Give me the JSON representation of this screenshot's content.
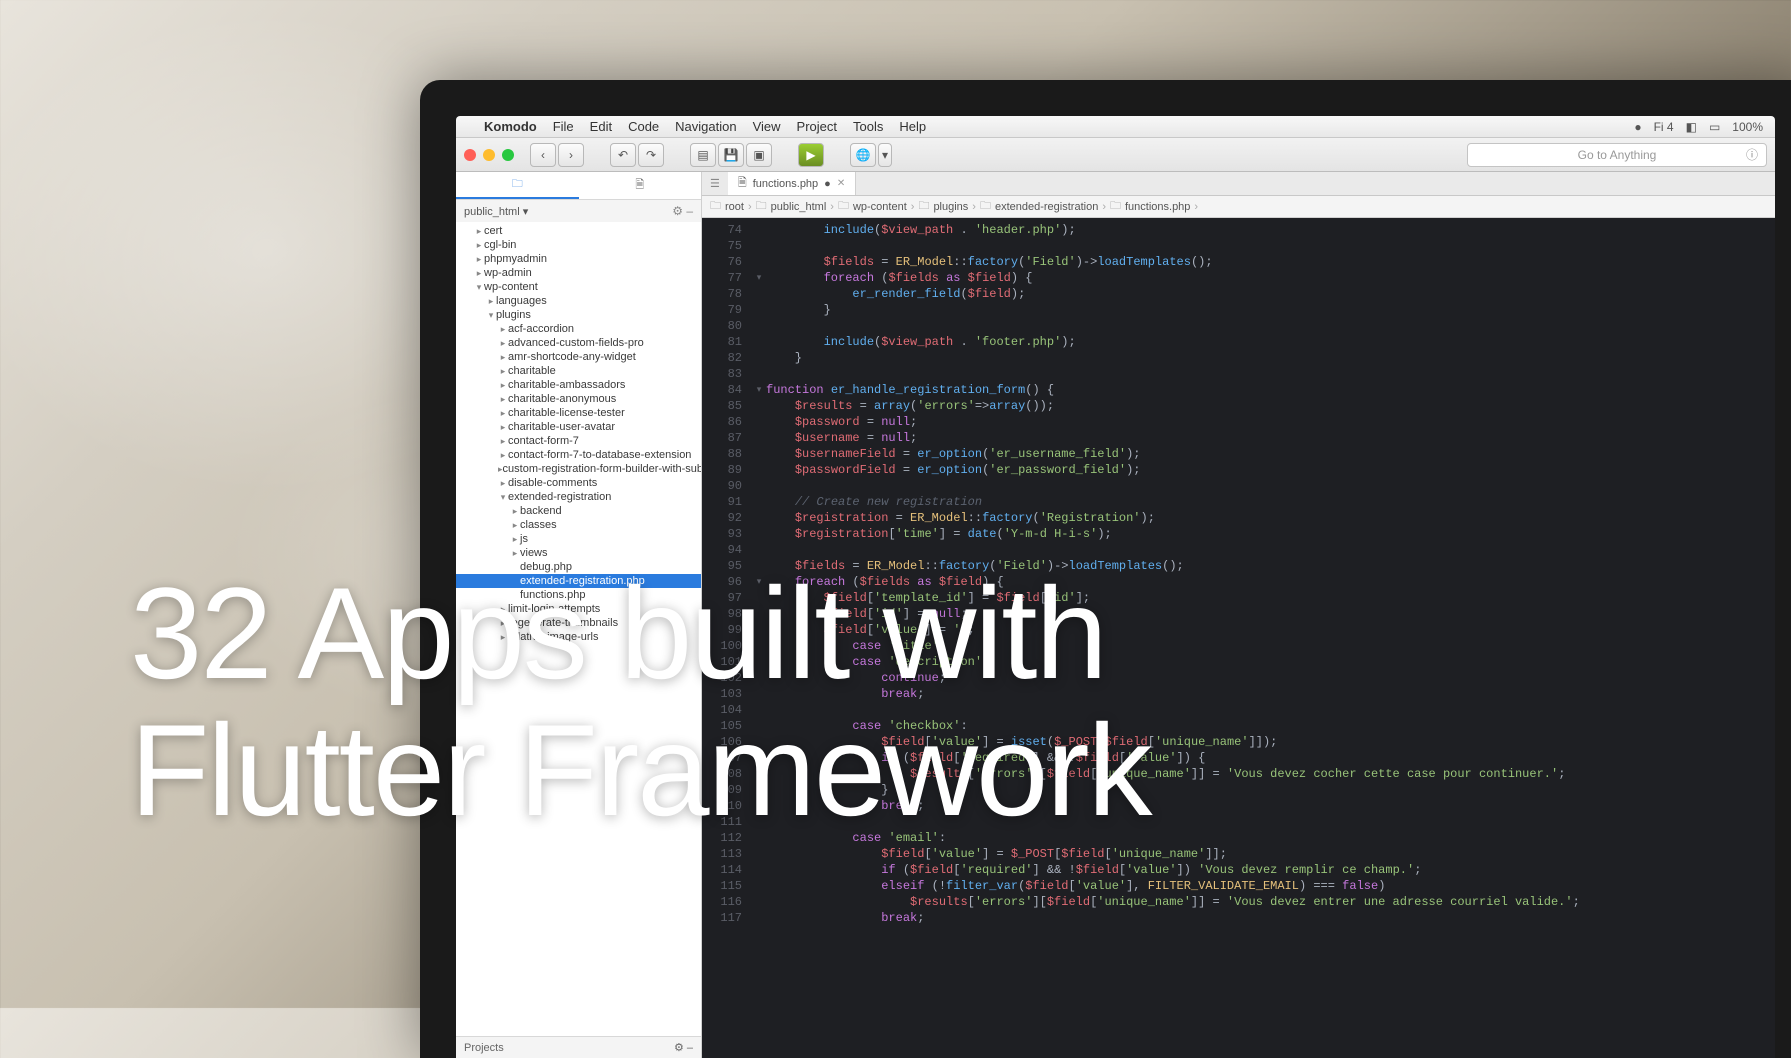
{
  "hero": {
    "line1": "32 Apps built with",
    "line2": "Flutter Framework"
  },
  "menubar": {
    "app": "Komodo",
    "items": [
      "File",
      "Edit",
      "Code",
      "Navigation",
      "View",
      "Project",
      "Tools",
      "Help"
    ],
    "right": [
      "Fi 4",
      "◧",
      "100%"
    ]
  },
  "toolbar": {
    "search_placeholder": "Go to Anything"
  },
  "sidebar": {
    "header": "public_html",
    "footer": "Projects",
    "tree": [
      {
        "d": 1,
        "a": ">",
        "t": "cert"
      },
      {
        "d": 1,
        "a": ">",
        "t": "cgl-bin"
      },
      {
        "d": 1,
        "a": ">",
        "t": "phpmyadmin"
      },
      {
        "d": 1,
        "a": ">",
        "t": "wp-admin"
      },
      {
        "d": 1,
        "a": "v",
        "t": "wp-content"
      },
      {
        "d": 2,
        "a": ">",
        "t": "languages"
      },
      {
        "d": 2,
        "a": "v",
        "t": "plugins"
      },
      {
        "d": 3,
        "a": ">",
        "t": "acf-accordion"
      },
      {
        "d": 3,
        "a": ">",
        "t": "advanced-custom-fields-pro"
      },
      {
        "d": 3,
        "a": ">",
        "t": "amr-shortcode-any-widget"
      },
      {
        "d": 3,
        "a": ">",
        "t": "charitable"
      },
      {
        "d": 3,
        "a": ">",
        "t": "charitable-ambassadors"
      },
      {
        "d": 3,
        "a": ">",
        "t": "charitable-anonymous"
      },
      {
        "d": 3,
        "a": ">",
        "t": "charitable-license-tester"
      },
      {
        "d": 3,
        "a": ">",
        "t": "charitable-user-avatar"
      },
      {
        "d": 3,
        "a": ">",
        "t": "contact-form-7"
      },
      {
        "d": 3,
        "a": ">",
        "t": "contact-form-7-to-database-extension"
      },
      {
        "d": 3,
        "a": ">",
        "t": "custom-registration-form-builder-with-submissi"
      },
      {
        "d": 3,
        "a": ">",
        "t": "disable-comments"
      },
      {
        "d": 3,
        "a": "v",
        "t": "extended-registration"
      },
      {
        "d": 4,
        "a": ">",
        "t": "backend"
      },
      {
        "d": 4,
        "a": ">",
        "t": "classes"
      },
      {
        "d": 4,
        "a": ">",
        "t": "js"
      },
      {
        "d": 4,
        "a": ">",
        "t": "views"
      },
      {
        "d": 4,
        "a": "",
        "t": "debug.php"
      },
      {
        "d": 4,
        "a": "",
        "t": "extended-registration.php",
        "sel": true
      },
      {
        "d": 4,
        "a": "",
        "t": "functions.php"
      },
      {
        "d": 3,
        "a": ">",
        "t": "limit-login-attempts"
      },
      {
        "d": 3,
        "a": ">",
        "t": "regenerate-thumbnails"
      },
      {
        "d": 3,
        "a": ">",
        "t": "relative-image-urls"
      }
    ]
  },
  "editor": {
    "tab": "functions.php",
    "crumbs": [
      "root",
      "public_html",
      "wp-content",
      "plugins",
      "extended-registration",
      "functions.php"
    ],
    "lines": [
      {
        "n": 74,
        "html": "        <span class='fn'>include</span>(<span class='var'>$view_path</span> . <span class='str'>'header.php'</span>);"
      },
      {
        "n": 75,
        "html": ""
      },
      {
        "n": 76,
        "html": "        <span class='var'>$fields</span> = <span class='cls'>ER_Model</span>::<span class='fn'>factory</span>(<span class='str'>'Field'</span>)-><span class='fn'>loadTemplates</span>();"
      },
      {
        "n": 77,
        "fold": "v",
        "html": "        <span class='kw'>foreach</span> (<span class='var'>$fields</span> <span class='kw'>as</span> <span class='var'>$field</span>) {"
      },
      {
        "n": 78,
        "html": "            <span class='fn'>er_render_field</span>(<span class='var'>$field</span>);"
      },
      {
        "n": 79,
        "html": "        }"
      },
      {
        "n": 80,
        "html": ""
      },
      {
        "n": 81,
        "html": "        <span class='fn'>include</span>(<span class='var'>$view_path</span> . <span class='str'>'footer.php'</span>);"
      },
      {
        "n": 82,
        "html": "    }"
      },
      {
        "n": 83,
        "html": ""
      },
      {
        "n": 84,
        "fold": "v",
        "html": "<span class='kw'>function</span> <span class='fn'>er_handle_registration_form</span>() {"
      },
      {
        "n": 85,
        "html": "    <span class='var'>$results</span> = <span class='fn'>array</span>(<span class='str'>'errors'</span>=><span class='fn'>array</span>());"
      },
      {
        "n": 86,
        "html": "    <span class='var'>$password</span> = <span class='kw'>null</span>;"
      },
      {
        "n": 87,
        "html": "    <span class='var'>$username</span> = <span class='kw'>null</span>;"
      },
      {
        "n": 88,
        "html": "    <span class='var'>$usernameField</span> = <span class='fn'>er_option</span>(<span class='str'>'er_username_field'</span>);"
      },
      {
        "n": 89,
        "html": "    <span class='var'>$passwordField</span> = <span class='fn'>er_option</span>(<span class='str'>'er_password_field'</span>);"
      },
      {
        "n": 90,
        "html": ""
      },
      {
        "n": 91,
        "html": "    <span class='cmt'>// Create new registration</span>"
      },
      {
        "n": 92,
        "html": "    <span class='var'>$registration</span> = <span class='cls'>ER_Model</span>::<span class='fn'>factory</span>(<span class='str'>'Registration'</span>);"
      },
      {
        "n": 93,
        "html": "    <span class='var'>$registration</span>[<span class='str'>'time'</span>] = <span class='fn'>date</span>(<span class='str'>'Y-m-d H-i-s'</span>);"
      },
      {
        "n": 94,
        "html": ""
      },
      {
        "n": 95,
        "html": "    <span class='var'>$fields</span> = <span class='cls'>ER_Model</span>::<span class='fn'>factory</span>(<span class='str'>'Field'</span>)-><span class='fn'>loadTemplates</span>();"
      },
      {
        "n": 96,
        "fold": "v",
        "html": "    <span class='kw'>foreach</span> (<span class='var'>$fields</span> <span class='kw'>as</span> <span class='var'>$field</span>) {"
      },
      {
        "n": 97,
        "html": "        <span class='var'>$field</span>[<span class='str'>'template_id'</span>] = <span class='var'>$field</span>[<span class='str'>'id'</span>];"
      },
      {
        "n": 98,
        "html": "        <span class='var'>$field</span>[<span class='str'>'id'</span>] = <span class='kw'>null</span>;"
      },
      {
        "n": 99,
        "html": "        <span class='var'>$field</span>[<span class='str'>'value'</span>] = <span class='str'>''</span>;"
      },
      {
        "n": 100,
        "html": "            <span class='kw'>case</span> <span class='str'>'title'</span>:"
      },
      {
        "n": 101,
        "html": "            <span class='kw'>case</span> <span class='str'>'description'</span>:"
      },
      {
        "n": 102,
        "html": "                <span class='kw'>continue</span>;"
      },
      {
        "n": 103,
        "html": "                <span class='kw'>break</span>;"
      },
      {
        "n": 104,
        "html": ""
      },
      {
        "n": 105,
        "html": "            <span class='kw'>case</span> <span class='str'>'checkbox'</span>:"
      },
      {
        "n": 106,
        "html": "                <span class='var'>$field</span>[<span class='str'>'value'</span>] = <span class='fn'>isset</span>(<span class='var'>$_POST</span>[<span class='var'>$field</span>[<span class='str'>'unique_name'</span>]]);"
      },
      {
        "n": 107,
        "html": "                <span class='kw'>if</span> (<span class='var'>$field</span>[<span class='str'>'required'</span>] && !<span class='var'>$field</span>[<span class='str'>'value'</span>]) {"
      },
      {
        "n": 108,
        "html": "                    <span class='var'>$results</span>[<span class='str'>'errors'</span>][<span class='var'>$field</span>[<span class='str'>'unique_name'</span>]] = <span class='str'>'Vous devez cocher cette case pour continuer.'</span>;"
      },
      {
        "n": 109,
        "html": "                }"
      },
      {
        "n": 110,
        "html": "                <span class='kw'>break</span>;"
      },
      {
        "n": 111,
        "html": ""
      },
      {
        "n": 112,
        "html": "            <span class='kw'>case</span> <span class='str'>'email'</span>:"
      },
      {
        "n": 113,
        "html": "                <span class='var'>$field</span>[<span class='str'>'value'</span>] = <span class='var'>$_POST</span>[<span class='var'>$field</span>[<span class='str'>'unique_name'</span>]];"
      },
      {
        "n": 114,
        "html": "                <span class='kw'>if</span> (<span class='var'>$field</span>[<span class='str'>'required'</span>] && !<span class='var'>$field</span>[<span class='str'>'value'</span>]) <span class='str'>'Vous devez remplir ce champ.'</span>;"
      },
      {
        "n": 115,
        "html": "                <span class='kw'>elseif</span> (!<span class='fn'>filter_var</span>(<span class='var'>$field</span>[<span class='str'>'value'</span>], <span class='cls'>FILTER_VALIDATE_EMAIL</span>) === <span class='kw'>false</span>)"
      },
      {
        "n": 116,
        "html": "                    <span class='var'>$results</span>[<span class='str'>'errors'</span>][<span class='var'>$field</span>[<span class='str'>'unique_name'</span>]] = <span class='str'>'Vous devez entrer une adresse courriel valide.'</span>;"
      },
      {
        "n": 117,
        "html": "                <span class='kw'>break</span>;"
      }
    ]
  }
}
